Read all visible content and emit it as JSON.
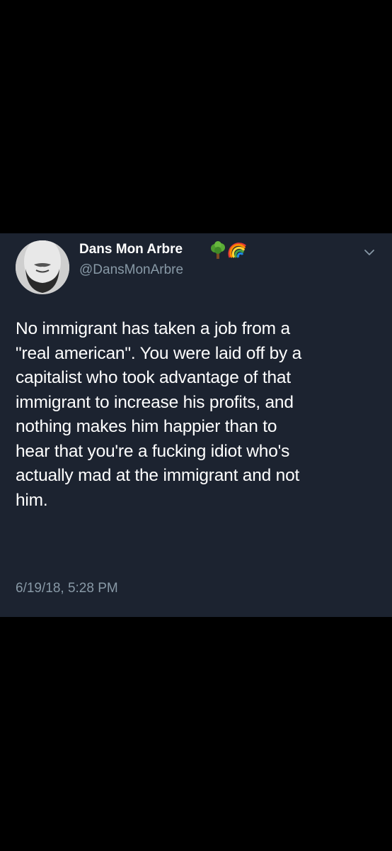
{
  "tweet": {
    "display_name": "Dans Mon Arbre",
    "handle": "@DansMonArbre",
    "name_emojis": [
      "tree-emoji",
      "rainbow-emoji"
    ],
    "text_lines": [
      "No immigrant has taken a job from a",
      "\"real american\".  You were laid off by a",
      "capitalist who took advantage of that",
      "immigrant to increase his profits, and",
      "nothing makes him happier than to",
      "hear that you're a fucking idiot who's",
      "actually mad at the immigrant and not",
      "him."
    ],
    "timestamp": "6/19/18, 5:28 PM",
    "menu_icon": "chevron-down-icon"
  },
  "colors": {
    "background": "#000000",
    "card": "#1c2330",
    "text": "#ffffff",
    "secondary_text": "#8899a6"
  }
}
